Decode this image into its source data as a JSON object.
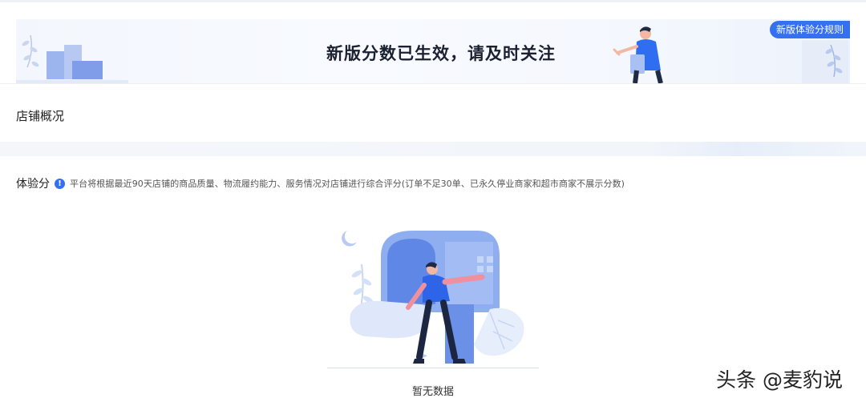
{
  "banner": {
    "title": "新版分数已生效，请及时关注",
    "rules_button": "新版体验分规则"
  },
  "overview": {
    "title": "店铺概况"
  },
  "experience_score": {
    "label": "体验分",
    "info_icon": "info-icon",
    "description": "平台将根据最近90天店铺的商品质量、物流履约能力、服务情况对店铺进行综合评分(订单不足30单、已永久停业商家和超市商家不展示分数)"
  },
  "empty_state": {
    "text": "暂无数据"
  },
  "watermark": {
    "text": "头条 @麦豹说"
  },
  "colors": {
    "accent": "#3570f0",
    "illustration": "#7da2ee"
  }
}
